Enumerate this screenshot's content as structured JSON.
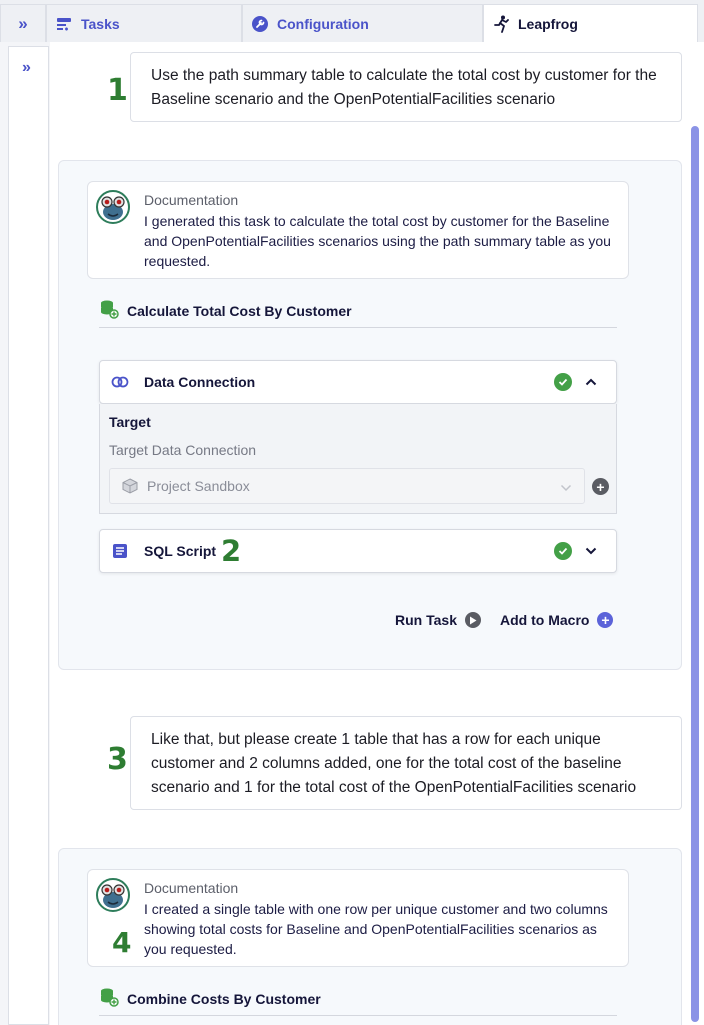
{
  "tabs": {
    "collapse_glyph": "»",
    "items": [
      {
        "label": "Tasks",
        "icon": "tasks-icon"
      },
      {
        "label": "Configuration",
        "icon": "wrench-icon"
      },
      {
        "label": "Leapfrog",
        "icon": "leapfrog-icon"
      }
    ]
  },
  "sidebar": {
    "expand_glyph": "»"
  },
  "conversation": {
    "step1": {
      "number": "1",
      "prompt": "Use the path summary table to calculate the total cost by customer for the Baseline scenario and the OpenPotentialFacilities scenario"
    },
    "response1": {
      "doc_title": "Documentation",
      "doc_body": "I generated this task to calculate the total cost by customer for the Baseline and OpenPotentialFacilities scenarios using the path summary table as you requested.",
      "task_name": "Calculate Total Cost By Customer",
      "data_connection": {
        "title": "Data Connection",
        "target_label": "Target",
        "target_sub": "Target Data Connection",
        "selected": "Project Sandbox"
      },
      "sql_script": {
        "title": "SQL Script",
        "number": "2"
      },
      "run_task": "Run Task",
      "add_to_macro": "Add to Macro"
    },
    "step3": {
      "number": "3",
      "prompt": "Like that, but please create 1 table that has a row for each unique customer and 2 columns added, one for the total cost of the baseline scenario and 1 for the total cost of the OpenPotentialFacilities scenario"
    },
    "response2": {
      "number": "4",
      "doc_title": "Documentation",
      "doc_body": "I created a single table with one row per unique customer and two columns showing total costs for Baseline and OpenPotentialFacilities scenarios as you requested.",
      "task_name": "Combine Costs By Customer"
    }
  },
  "colors": {
    "accent": "#4a53c9",
    "step_number": "#2e7d32",
    "success": "#43a047",
    "scrollbar": "#8b93e6"
  }
}
